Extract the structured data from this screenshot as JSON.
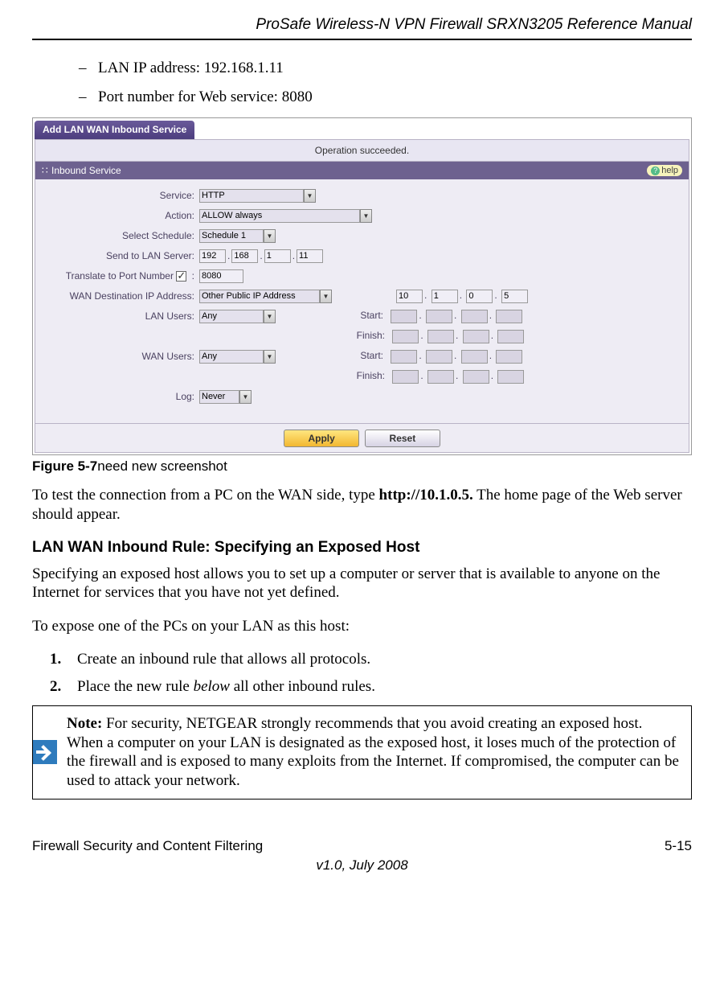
{
  "header": {
    "manual_title": "ProSafe Wireless-N VPN Firewall SRXN3205 Reference Manual"
  },
  "bullets": {
    "b1": "LAN IP address: 192.168.1.11",
    "b2": "Port number for Web service: 8080"
  },
  "ui": {
    "tab_title": "Add LAN WAN Inbound Service",
    "status_msg": "Operation succeeded.",
    "panel_title": "Inbound Service",
    "help_label": "help",
    "labels": {
      "service": "Service:",
      "action": "Action:",
      "schedule": "Select Schedule:",
      "send_lan": "Send to LAN Server:",
      "translate": "Translate to Port Number",
      "wan_dest": "WAN Destination IP Address:",
      "lan_users": "LAN Users:",
      "wan_users": "WAN Users:",
      "log": "Log:",
      "start": "Start:",
      "finish": "Finish:"
    },
    "values": {
      "service": "HTTP",
      "action": "ALLOW always",
      "schedule": "Schedule 1",
      "lan_ip": {
        "a": "192",
        "b": "168",
        "c": "1",
        "d": "11"
      },
      "port": "8080",
      "wan_dest_sel": "Other Public IP Address",
      "wan_dest_ip": {
        "a": "10",
        "b": "1",
        "c": "0",
        "d": "5"
      },
      "lan_users": "Any",
      "wan_users": "Any",
      "log": "Never"
    },
    "buttons": {
      "apply": "Apply",
      "reset": "Reset"
    }
  },
  "caption": {
    "fig": "Figure 5-7",
    "rest": "need new screenshot"
  },
  "para1a": "To test the connection from a PC on the WAN side, type ",
  "para1b": "http://10.1.0.5.",
  "para1c": " The home page of the Web server should appear.",
  "h2": "LAN WAN Inbound Rule: Specifying an Exposed Host",
  "para2": "Specifying an exposed host allows you to set up a computer or server that is available to anyone on the Internet for services that you have not yet defined.",
  "para3": "To expose one of the PCs on your LAN as this host:",
  "step1": "Create an inbound rule that allows all protocols.",
  "step2a": "Place the new rule ",
  "step2b": "below",
  "step2c": " all other inbound rules.",
  "note_label": "Note:",
  "note_body": " For security, NETGEAR strongly recommends that you avoid creating an exposed host. When a computer on your LAN is designated as the exposed host, it loses much of the protection of the firewall and is exposed to many exploits from the Internet. If compromised, the computer can be used to attack your network.",
  "footer": {
    "section": "Firewall Security and Content Filtering",
    "page": "5-15",
    "version": "v1.0, July 2008"
  }
}
